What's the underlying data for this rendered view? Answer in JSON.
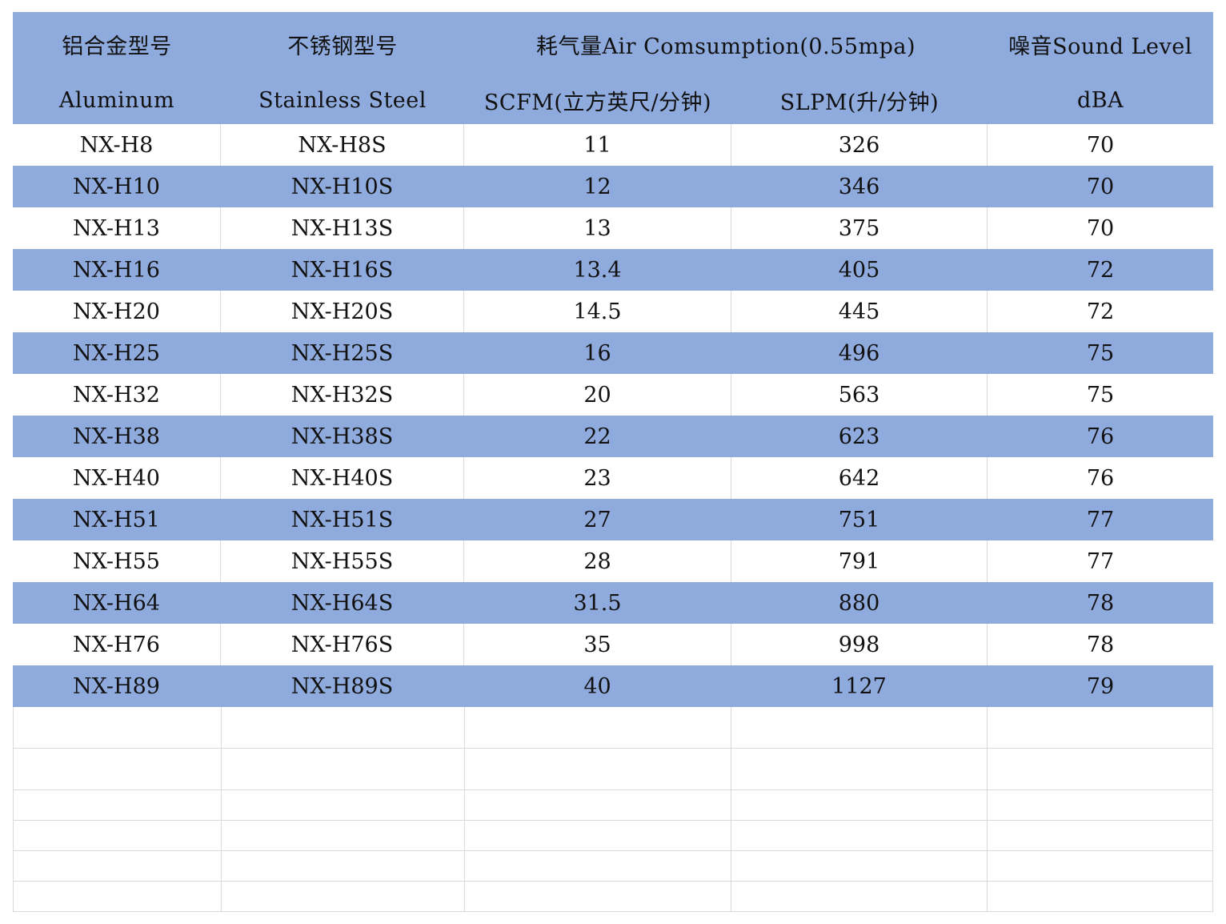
{
  "table": {
    "header_row1": {
      "col0": "铝合金型号",
      "col1": "不锈钢型号",
      "col23": "耗气量Air Comsumption(0.55mpa)",
      "col4": "噪音Sound Level"
    },
    "header_row2": {
      "col0": "Aluminum",
      "col1": "Stainless Steel",
      "col2": "SCFM(立方英尺/分钟)",
      "col3": "SLPM(升/分钟)",
      "col4": "dBA"
    },
    "rows": [
      [
        "NX-H8",
        "NX-H8S",
        "11",
        "326",
        "70"
      ],
      [
        "NX-H10",
        "NX-H10S",
        "12",
        "346",
        "70"
      ],
      [
        "NX-H13",
        "NX-H13S",
        "13",
        "375",
        "70"
      ],
      [
        "NX-H16",
        "NX-H16S",
        "13.4",
        "405",
        "72"
      ],
      [
        "NX-H20",
        "NX-H20S",
        "14.5",
        "445",
        "72"
      ],
      [
        "NX-H25",
        "NX-H25S",
        "16",
        "496",
        "75"
      ],
      [
        "NX-H32",
        "NX-H32S",
        "20",
        "563",
        "75"
      ],
      [
        "NX-H38",
        "NX-H38S",
        "22",
        "623",
        "76"
      ],
      [
        "NX-H40",
        "NX-H40S",
        "23",
        "642",
        "76"
      ],
      [
        "NX-H51",
        "NX-H51S",
        "27",
        "751",
        "77"
      ],
      [
        "NX-H55",
        "NX-H55S",
        "28",
        "791",
        "77"
      ],
      [
        "NX-H64",
        "NX-H64S",
        "31.5",
        "880",
        "78"
      ],
      [
        "NX-H76",
        "NX-H76S",
        "35",
        "998",
        "78"
      ],
      [
        "NX-H89",
        "NX-H89S",
        "40",
        "1127",
        "79"
      ]
    ]
  },
  "colors": {
    "band": "#8faadc",
    "grid": "#d9d9d9",
    "cell_marker": "#1a8a2e"
  }
}
